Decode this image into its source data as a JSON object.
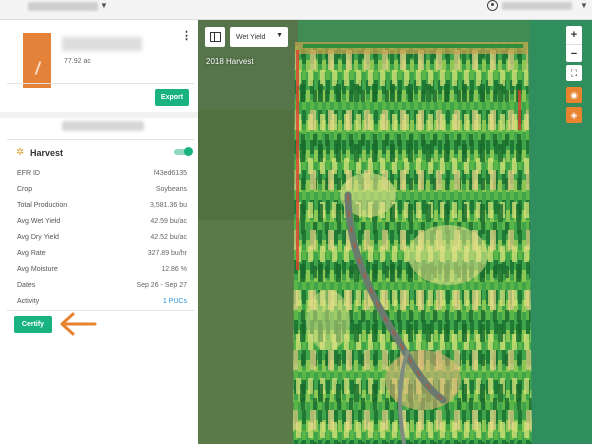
{
  "panel": {
    "field_area": "77.92 ac",
    "export_label": "Export",
    "harvest_title": "Harvest",
    "rows": [
      {
        "label": "EFR ID",
        "value": "f43ed6135"
      },
      {
        "label": "Crop",
        "value": "Soybeans"
      },
      {
        "label": "Total Production",
        "value": "3,581.36 bu"
      },
      {
        "label": "Avg Wet Yield",
        "value": "42.59 bu/ac"
      },
      {
        "label": "Avg Dry Yield",
        "value": "42.52 bu/ac"
      },
      {
        "label": "Avg Rate",
        "value": "327.89 bu/hr"
      },
      {
        "label": "Avg Moisture",
        "value": "12.86 %"
      },
      {
        "label": "Dates",
        "value": "Sep 26 - Sep 27"
      },
      {
        "label": "Activity",
        "value": "1 PUCs"
      }
    ],
    "certify_label": "Certify"
  },
  "map": {
    "layer_select_value": "Wet Yield",
    "title": "2018 Harvest",
    "zoom_in": "+",
    "zoom_out": "−"
  },
  "icons": {
    "kebab": "kebab-menu-icon",
    "wheat": "wheat-icon",
    "fullscreen": "fullscreen-icon",
    "locate": "locate-icon",
    "layers": "layers-icon"
  },
  "colors": {
    "accent_green": "#19b382",
    "annotation_orange": "#e8832f",
    "link_blue": "#2a8fd1"
  }
}
